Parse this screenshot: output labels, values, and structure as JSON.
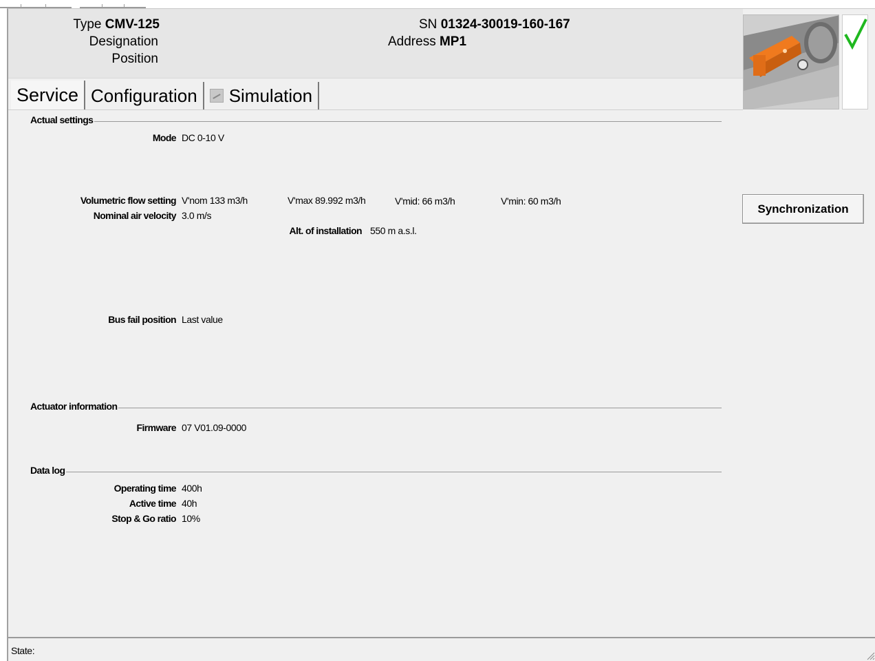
{
  "header": {
    "type_label": "Type",
    "type_value": "CMV-125",
    "designation_label": "Designation",
    "position_label": "Position",
    "sn_label": "SN",
    "sn_value": "01324-30019-160-167",
    "address_label": "Address",
    "address_value": "MP1"
  },
  "tabs": [
    {
      "label": "Service",
      "active": true
    },
    {
      "label": "Configuration",
      "active": false
    },
    {
      "label": "Simulation",
      "active": false
    }
  ],
  "sections": {
    "actual_settings": "Actual settings",
    "actuator_information": "Actuator information",
    "data_log": "Data log"
  },
  "fields": {
    "mode_label": "Mode",
    "mode_value": "DC 0-10 V",
    "volumetric_label": "Volumetric flow setting",
    "vnom": "V'nom 133 m3/h",
    "vmax": "V'max 89.992 m3/h",
    "vmid": "V'mid: 66 m3/h",
    "vmin": "V'min: 60 m3/h",
    "nominal_velocity_label": "Nominal air velocity",
    "nominal_velocity_value": "3.0 m/s",
    "alt_label": "Alt. of installation",
    "alt_value": "550 m a.s.l.",
    "bus_fail_label": "Bus fail position",
    "bus_fail_value": "Last value",
    "firmware_label": "Firmware",
    "firmware_value": "07 V01.09-0000",
    "operating_time_label": "Operating time",
    "operating_time_value": "400h",
    "active_time_label": "Active time",
    "active_time_value": "40h",
    "stop_go_label": "Stop & Go ratio",
    "stop_go_value": "10%"
  },
  "buttons": {
    "synchronization": "Synchronization"
  },
  "status": {
    "state_label": "State:"
  },
  "colors": {
    "check": "#1fb81f",
    "actuator_orange": "#f07a1e"
  },
  "icons": {
    "status_check": "check-icon",
    "device_image": "actuator-image",
    "simulation_tab": "simulation-icon",
    "resize": "resize-grip-icon"
  }
}
